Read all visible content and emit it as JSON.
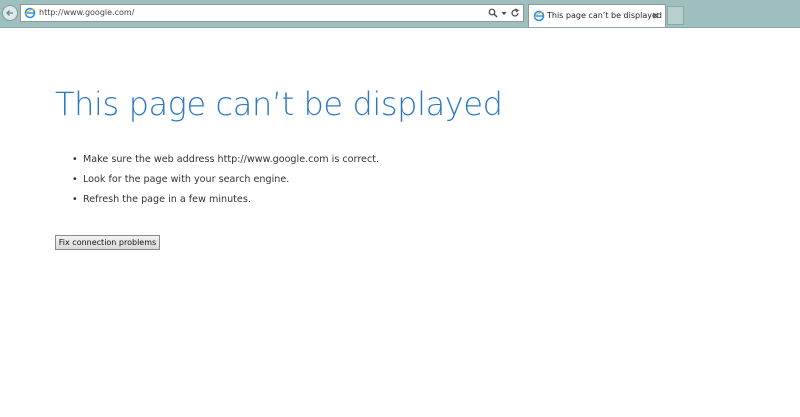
{
  "browser": {
    "url": "http://www.google.com/",
    "tab_title": "This page can’t be displayed",
    "icons": {
      "back": "back-arrow-icon",
      "page": "ie-page-icon",
      "search": "search-icon",
      "dropdown": "chevron-down-icon",
      "refresh": "refresh-icon",
      "close": "close-icon"
    },
    "colors": {
      "frame": "#9fbfbf",
      "ie_blue": "#1e90ff"
    }
  },
  "content": {
    "heading": "This page can’t be displayed",
    "bullets": [
      "Make sure the web address http://www.google.com is correct.",
      "Look for the page with your search engine.",
      "Refresh the page in a few minutes."
    ],
    "fix_button_label": "Fix connection problems",
    "colors": {
      "heading": "#2b78c5"
    }
  }
}
